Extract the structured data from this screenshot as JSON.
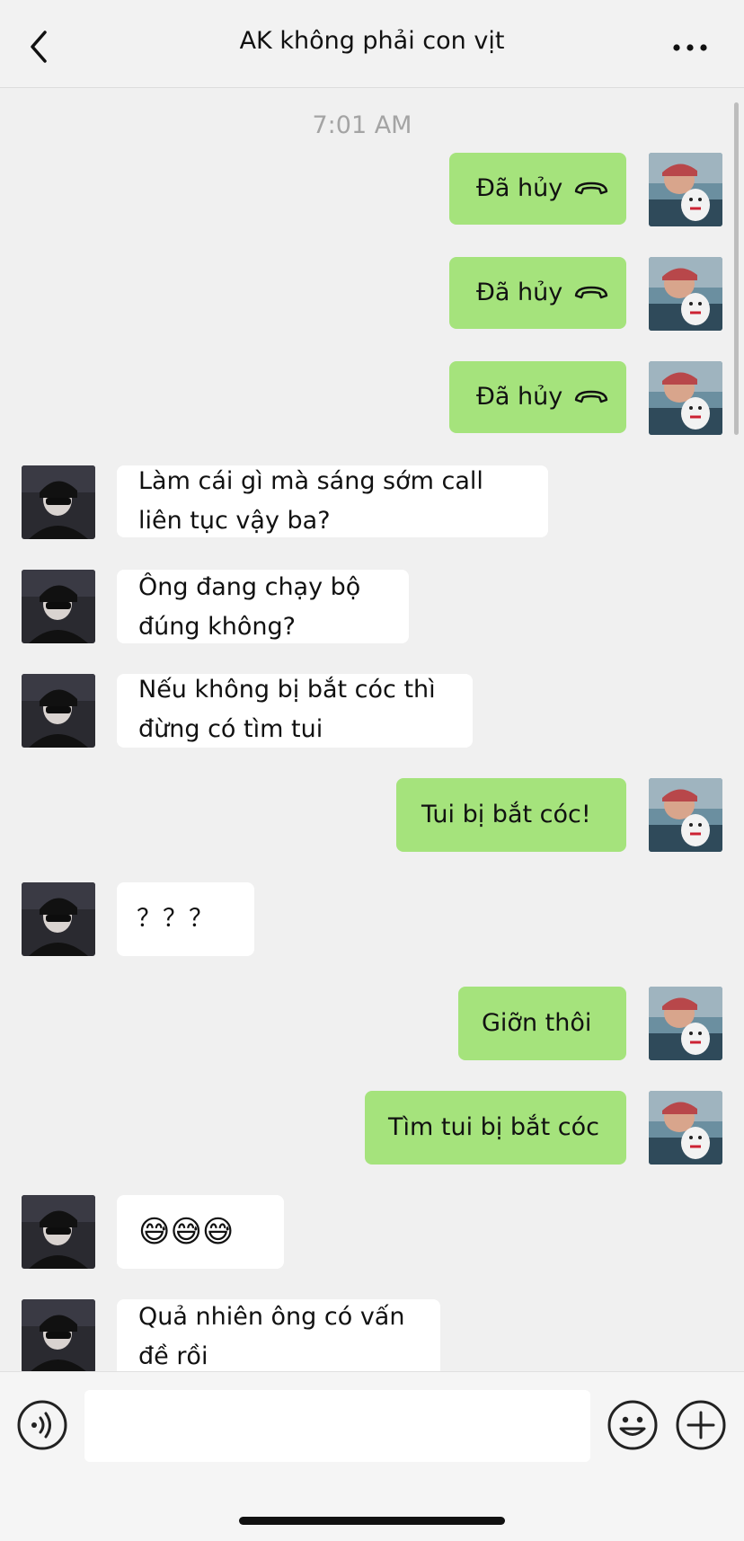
{
  "header": {
    "title": "AK không phải con vịt",
    "back_icon": "chevron-left-icon",
    "more_icon": "more-dots-icon"
  },
  "chat": {
    "timestamp": "7:01 AM",
    "messages": [
      {
        "from": "me",
        "text": "Đã hủy",
        "icon": "phone-hangup-icon"
      },
      {
        "from": "me",
        "text": "Đã hủy",
        "icon": "phone-hangup-icon"
      },
      {
        "from": "me",
        "text": "Đã hủy",
        "icon": "phone-hangup-icon"
      },
      {
        "from": "them",
        "text": "Làm cái gì mà sáng sớm call liên tục vậy ba?"
      },
      {
        "from": "them",
        "text": "Ông đang chạy bộ đúng không?"
      },
      {
        "from": "them",
        "text": "Nếu không bị bắt cóc thì đừng có tìm tui"
      },
      {
        "from": "me",
        "text": "Tui bị bắt cóc!"
      },
      {
        "from": "them",
        "text": "？？？"
      },
      {
        "from": "me",
        "text": "Giỡn thôi"
      },
      {
        "from": "me",
        "text": "Tìm tui bị bắt cóc"
      },
      {
        "from": "them",
        "text": "😅😅😅"
      },
      {
        "from": "them",
        "text": "Quả nhiên ông có vấn đề rồi"
      }
    ]
  },
  "composer": {
    "voice_icon": "voice-icon",
    "emoji_icon": "emoji-icon",
    "plus_icon": "plus-icon",
    "input_value": ""
  },
  "colors": {
    "my_bubble": "#a5e37c",
    "their_bubble": "#ffffff",
    "background": "#f0f0f0"
  }
}
